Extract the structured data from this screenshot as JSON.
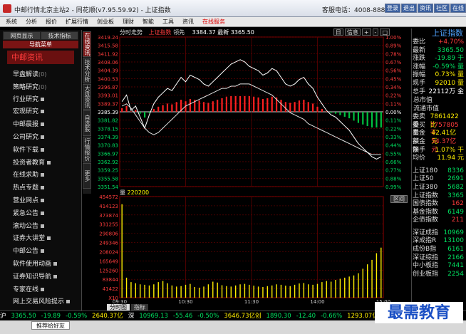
{
  "window": {
    "title": "中邮行情北京主站2 - 同花顺(v7.95.59.92) - 上证指数",
    "service_phone": "客服电话：4008-888-805",
    "buttons": [
      "登录",
      "退出",
      "资讯",
      "社区",
      "在线"
    ]
  },
  "menu": [
    "系统",
    "分析",
    "报价",
    "扩展行情",
    "创业板",
    "理财",
    "智能",
    "工具",
    "资讯",
    "在线服务"
  ],
  "left_panel": {
    "tabs": [
      "网页显示",
      "技术指标"
    ],
    "subtab": "导航菜单",
    "header": "中邮资讯",
    "items": [
      {
        "label": "早盘解读",
        "count": "(0)"
      },
      {
        "label": "策略研究",
        "count": "(0)"
      },
      {
        "label": "行业研究",
        "count": ""
      },
      {
        "label": "宏观研究",
        "count": ""
      },
      {
        "label": "中邮晨报",
        "count": ""
      },
      {
        "label": "公司研究",
        "count": ""
      },
      {
        "label": "软件下载",
        "count": ""
      },
      {
        "label": "投资者教育",
        "count": ""
      },
      {
        "label": "在线求助",
        "count": ""
      },
      {
        "label": "热点专题",
        "count": ""
      },
      {
        "label": "营业网点",
        "count": ""
      },
      {
        "label": "紧急公告",
        "count": ""
      },
      {
        "label": "滚动公告",
        "count": ""
      },
      {
        "label": "证券大讲堂",
        "count": ""
      },
      {
        "label": "中邮公告",
        "count": ""
      },
      {
        "label": "软件使用动画",
        "count": ""
      },
      {
        "label": "证券知识导航",
        "count": ""
      },
      {
        "label": "专家在线",
        "count": ""
      },
      {
        "label": "网上交易风险提示",
        "count": ""
      }
    ]
  },
  "vertical_tabs": [
    "在线资讯",
    "技术分析",
    "大盘资讯",
    "自选股",
    "行情报价",
    "更多"
  ],
  "chart_header": {
    "mode": "分时走势",
    "index": "上证指数",
    "status": "领先",
    "latest": "3384.37 最新 3365.50",
    "tools": [
      "日",
      "信息",
      "+",
      "-",
      "□"
    ]
  },
  "volume_label": "量",
  "volume_value": "220200",
  "zoom_button": "区间",
  "bottom_tabs": [
    "分时图",
    "指标"
  ],
  "chart_data": {
    "type": "line",
    "subtitle": "分时走势 上证指数",
    "prev_close": 3385.39,
    "price_ticks": [
      "3419.24",
      "3415.58",
      "3411.92",
      "3408.06",
      "3404.39",
      "3400.53",
      "3396.87",
      "3393.01",
      "3389.37",
      "3385.39",
      "3381.82",
      "3378.15",
      "3374.39",
      "3370.83",
      "3366.97",
      "3362.92",
      "3359.25",
      "3355.58",
      "3351.54"
    ],
    "pct_ticks": [
      "1.00%",
      "0.89%",
      "0.78%",
      "0.67%",
      "0.56%",
      "0.45%",
      "0.34%",
      "0.22%",
      "0.11%",
      "0.00%",
      "0.11%",
      "0.22%",
      "0.33%",
      "0.44%",
      "0.55%",
      "0.66%",
      "0.77%",
      "0.88%",
      "0.99%"
    ],
    "volume_ticks": [
      "454572",
      "414123",
      "373874",
      "331255",
      "290806",
      "249346",
      "208024",
      "165649",
      "125260",
      "83844",
      "41422",
      "X10"
    ],
    "time_ticks": [
      "09:30",
      "10:30",
      "11:30",
      "14:00",
      "15:00"
    ],
    "price_line": [
      3390,
      3393,
      3386,
      3388,
      3383,
      3378,
      3384,
      3389,
      3392,
      3394,
      3396,
      3395,
      3398,
      3401,
      3399,
      3402,
      3401,
      3400,
      3398,
      3397,
      3399,
      3401,
      3403,
      3405,
      3407,
      3408,
      3409,
      3408,
      3406,
      3405,
      3404,
      3402,
      3403,
      3405,
      3404,
      3401,
      3398,
      3397,
      3398,
      3400,
      3401,
      3398,
      3396,
      3392,
      3389,
      3386,
      3384,
      3383,
      3381,
      3379,
      3377,
      3374,
      3371,
      3369,
      3367,
      3365,
      3364,
      3365
    ],
    "avg_line": [
      3388,
      3389,
      3387,
      3384,
      3381,
      3378,
      3376,
      3375,
      3376,
      3378,
      3380,
      3382,
      3384,
      3386,
      3388,
      3389,
      3390,
      3391,
      3392,
      3393,
      3394,
      3395,
      3396,
      3396,
      3397,
      3397,
      3398,
      3398,
      3398,
      3397,
      3396,
      3395,
      3394,
      3393,
      3391,
      3389,
      3387,
      3385,
      3384,
      3383,
      3382,
      3380,
      3379,
      3378,
      3377,
      3376,
      3375,
      3374,
      3373,
      3372,
      3371,
      3370,
      3369,
      3368,
      3367,
      3366,
      3366,
      3366
    ],
    "volume_bars": [
      420000,
      90000,
      70000,
      65000,
      60000,
      58000,
      55000,
      60000,
      70000,
      75000,
      65000,
      55000,
      50000,
      52000,
      58000,
      62000,
      48000,
      45000,
      50000,
      60000,
      72000,
      68000,
      56000,
      52000,
      50000,
      55000,
      60000,
      62000,
      58000,
      54000,
      50000,
      48000,
      52000,
      55000,
      60000,
      58000,
      54000,
      52000,
      58000,
      64000,
      66000,
      60000,
      58000,
      62000,
      70000,
      75000,
      72000,
      80000,
      85000,
      90000,
      95000,
      100000,
      110000,
      130000,
      150000,
      170000,
      200000,
      225000
    ]
  },
  "right_panel": {
    "title": "上证指数",
    "quotes": [
      {
        "k": "委比",
        "v": "+4.70%",
        "c": "red"
      },
      {
        "k": "最新",
        "v": "3365.50",
        "c": "green"
      },
      {
        "k": "涨跌",
        "v": "-19.89 于",
        "c": "green"
      },
      {
        "k": "涨幅",
        "v": "-0.59% 量",
        "c": "green"
      },
      {
        "k": "振幅",
        "v": "0.73% 量",
        "c": "yellow"
      },
      {
        "k": "现手",
        "v": "92010 量",
        "c": "yellow"
      },
      {
        "k": "总手",
        "v": "22112万 金",
        "c": "white"
      }
    ],
    "singles": [
      "总市值",
      "流通市值"
    ],
    "trades": [
      {
        "k": "委卖量",
        "v": "7861422 比",
        "c": "yellow"
      },
      {
        "k": "委买量",
        "v": "7757805 干",
        "c": "red"
      },
      {
        "k": "卖金额",
        "v": "42.41亿 元",
        "c": "yellow"
      },
      {
        "k": "买金额",
        "v": "54.37亿 元",
        "c": "red"
      },
      {
        "k": "换手",
        "v": "1.07% 干",
        "c": "yellow"
      },
      {
        "k": "均价",
        "v": "11.94 元",
        "c": "yellow"
      }
    ],
    "indexes": [
      {
        "k": "上证180",
        "v": "8336",
        "c": "green"
      },
      {
        "k": "上证50",
        "v": "2691",
        "c": "green"
      },
      {
        "k": "上证380",
        "v": "5682",
        "c": "green"
      },
      {
        "k": "上证指数",
        "v": "3365",
        "c": "green"
      },
      {
        "k": "国债指数",
        "v": "162",
        "c": "red"
      },
      {
        "k": "基金指数",
        "v": "6149",
        "c": "green"
      },
      {
        "k": "企债指数",
        "v": "211",
        "c": "red"
      }
    ],
    "indexes2": [
      {
        "k": "深证成指",
        "v": "10969",
        "c": "green"
      },
      {
        "k": "深成指R",
        "v": "13100",
        "c": "green"
      },
      {
        "k": "成份B指",
        "v": "6161",
        "c": "green"
      },
      {
        "k": "深证综指",
        "v": "2166",
        "c": "green"
      },
      {
        "k": "中小板指",
        "v": "7441",
        "c": "green"
      },
      {
        "k": "创业板指",
        "v": "2254",
        "c": "green"
      }
    ]
  },
  "ticker": [
    {
      "t": "沪",
      "c": "white"
    },
    {
      "t": "3365.50",
      "c": "green"
    },
    {
      "t": "-19.89",
      "c": "green"
    },
    {
      "t": "-0.59%",
      "c": "green"
    },
    {
      "t": "2640.37亿",
      "c": "yellow"
    },
    {
      "t": "深",
      "c": "white"
    },
    {
      "t": "10969.13",
      "c": "green"
    },
    {
      "t": "-55.46",
      "c": "green"
    },
    {
      "t": "-0.50%",
      "c": "green"
    },
    {
      "t": "3646.73亿创",
      "c": "yellow"
    },
    {
      "t": "1890.30",
      "c": "green"
    },
    {
      "t": "-12.40",
      "c": "green"
    },
    {
      "t": "-0.66%",
      "c": "green"
    },
    {
      "t": "1293.07亿",
      "c": "yellow"
    }
  ],
  "status_tab": "推荐给好友",
  "watermark": "最需教育"
}
